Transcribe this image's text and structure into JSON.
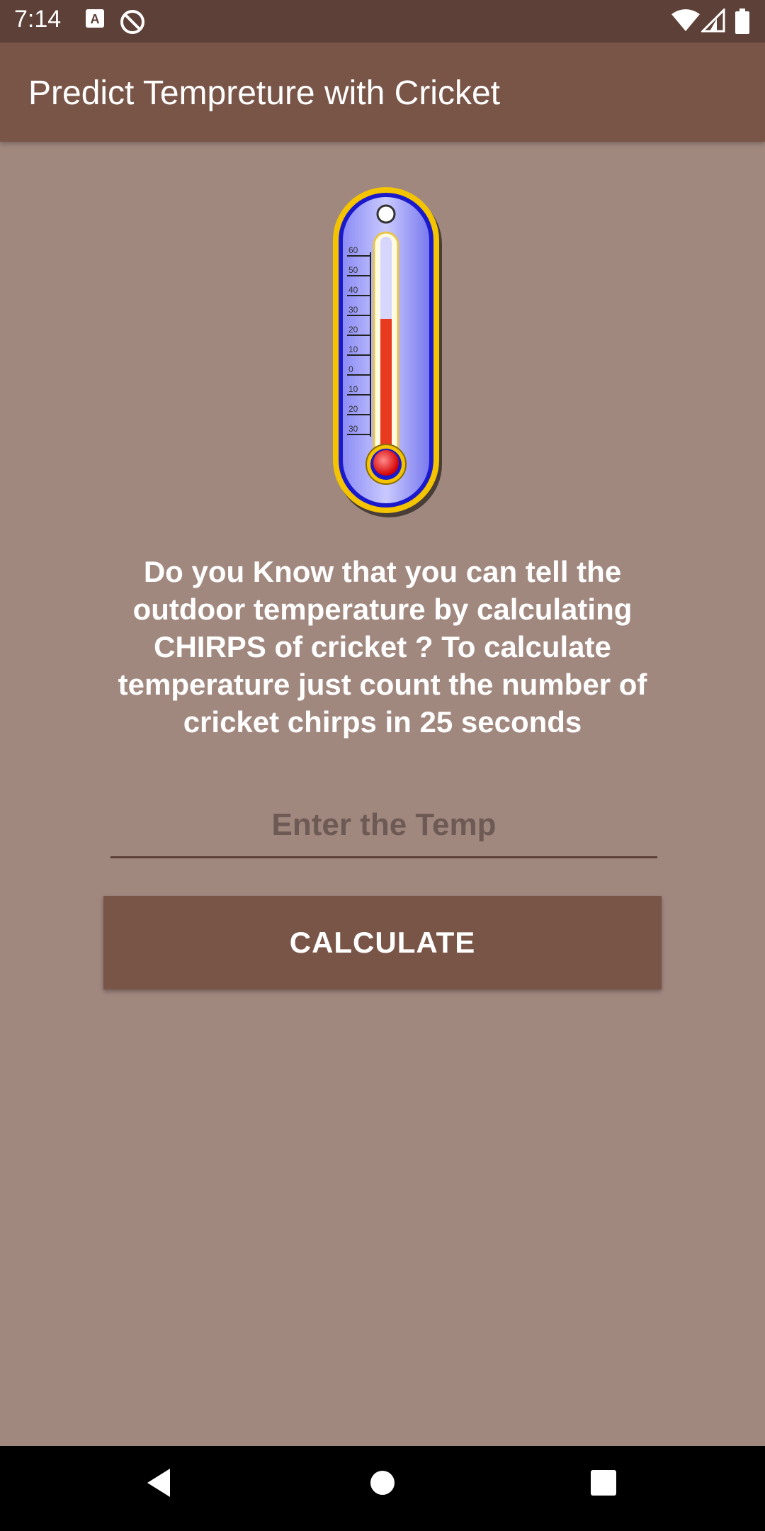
{
  "status_bar": {
    "time": "7:14",
    "left_icons": [
      "a-notification-icon",
      "sync-disabled-icon"
    ],
    "right_icons": [
      "wifi-icon",
      "signal-icon",
      "battery-icon"
    ]
  },
  "app_bar": {
    "title": "Predict Tempreture with Cricket"
  },
  "thermometer": {
    "scale_labels": [
      "60",
      "50",
      "40",
      "30",
      "20",
      "10",
      "0",
      "10",
      "20",
      "30"
    ]
  },
  "info_text": "Do you Know that you can tell the outdoor temperature by calculating CHIRPS of cricket ? To calculate temperature just count the number of cricket chirps in 25 seconds",
  "temp_input": {
    "placeholder": "Enter the Temp",
    "value": ""
  },
  "calculate_button": {
    "label": "CALCULATE"
  },
  "nav_bar": {
    "buttons": [
      "back-icon",
      "home-icon",
      "recents-icon"
    ]
  },
  "colors": {
    "background": "#a1887f",
    "app_bar": "#795548",
    "status_bar": "#5d4037",
    "button": "#795548"
  }
}
